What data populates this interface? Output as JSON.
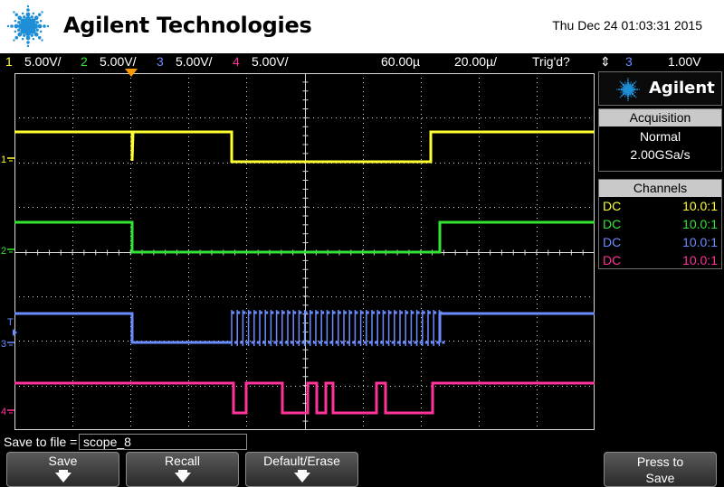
{
  "header": {
    "brand": "Agilent Technologies",
    "datetime": "Thu Dec 24 01:03:31 2015"
  },
  "status_bar": {
    "channels": [
      {
        "num": "1",
        "scale": "5.00V/",
        "color": "#ffff33"
      },
      {
        "num": "2",
        "scale": "5.00V/",
        "color": "#33e533"
      },
      {
        "num": "3",
        "scale": "5.00V/",
        "color": "#6b8cff"
      },
      {
        "num": "4",
        "scale": "5.00V/",
        "color": "#ff3399"
      }
    ],
    "horizontal_position": "60.00µ",
    "horizontal_scale": "20.00µ/",
    "trigger_state": "Trig'd?",
    "trigger_source": "3",
    "trigger_level": "1.00V"
  },
  "right_panel": {
    "logo_text": "Agilent",
    "acquisition": {
      "title": "Acquisition",
      "mode": "Normal",
      "sample_rate": "2.00GSa/s"
    },
    "channels": {
      "title": "Channels",
      "rows": [
        {
          "coupling": "DC",
          "probe": "10.0:1",
          "color": "#ffff33"
        },
        {
          "coupling": "DC",
          "probe": "10.0:1",
          "color": "#33e533"
        },
        {
          "coupling": "DC",
          "probe": "10.0:1",
          "color": "#6b8cff"
        },
        {
          "coupling": "DC",
          "probe": "10.0:1",
          "color": "#ff3399"
        }
      ]
    }
  },
  "ground_markers": [
    "1",
    "2",
    "3",
    "4"
  ],
  "trigger_marker": "T",
  "save_to_file": {
    "label": "Save to file =",
    "value": "scope_8"
  },
  "softkeys": [
    {
      "label": "Save"
    },
    {
      "label": "Recall"
    },
    {
      "label": "Default/Erase"
    }
  ],
  "press_to_save": [
    "Press to",
    "Save"
  ],
  "colors": {
    "ch1": "#ffff33",
    "ch2": "#33e533",
    "ch3": "#6b8cff",
    "ch4": "#ff3399",
    "trigger_marker": "#ff9900",
    "grid": "#d8d8d8",
    "logo_blue": "#1e8fd6"
  }
}
